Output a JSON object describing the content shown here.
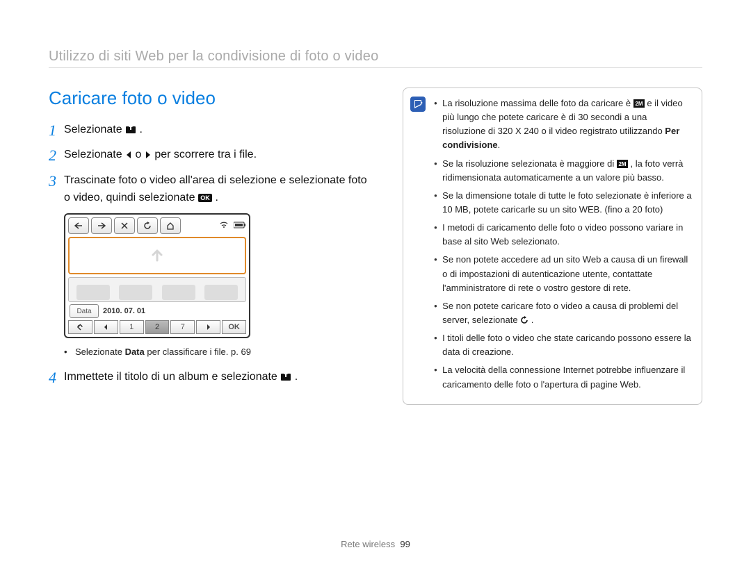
{
  "breadcrumb": "Utilizzo di siti Web per la condivisione di foto o video",
  "heading": "Caricare foto o video",
  "steps": {
    "s1": {
      "num": "1",
      "a": "Selezionate ",
      "b": "."
    },
    "s2": {
      "num": "2",
      "a": "Selezionate ",
      "b": " o ",
      "c": " per scorrere tra i file."
    },
    "s3": {
      "num": "3",
      "a": "Trascinate foto o video all'area di selezione e selezionate foto o video, quindi selezionate ",
      "b": "."
    },
    "s4": {
      "num": "4",
      "a": "Immettete il titolo di un album e selezionate ",
      "b": "."
    }
  },
  "cam": {
    "date_label": "Data",
    "date_value": "2010. 07. 01",
    "bottom": [
      "1",
      "2",
      "7"
    ]
  },
  "sub_bullet": {
    "a": "Selezionate ",
    "b_bold": "Data",
    "c": " per classificare i file. p. 69"
  },
  "notes": {
    "n1a": "La risoluzione massima delle foto da caricare è ",
    "n1b": " e il video più lungo che potete caricare è di 30 secondi a una risoluzione di 320 X 240 o il video registrato utilizzando ",
    "n1c_bold": "Per condivisione",
    "n1d": ".",
    "n2a": "Se la risoluzione selezionata è maggiore di ",
    "n2b": ", la foto verrà ridimensionata automaticamente a un valore più basso.",
    "n3": "Se la dimensione totale di tutte le foto selezionate è inferiore a 10 MB, potete caricarle su un sito WEB. (fino a 20 foto)",
    "n4": "I metodi di caricamento delle foto o video possono variare in base al sito Web selezionato.",
    "n5": "Se non potete accedere ad un sito Web a causa di un firewall o di impostazioni di autenticazione utente, contattate l'amministratore di rete o vostro gestore di rete.",
    "n6a": "Se non potete caricare foto o video a causa di problemi del server, selezionate ",
    "n6b": ".",
    "n7": "I titoli delle foto o video che state caricando possono essere la data di creazione.",
    "n8": "La velocità della connessione Internet potrebbe influenzare il caricamento delle foto o l'apertura di pagine Web."
  },
  "footer": {
    "section": "Rete wireless",
    "page": "99"
  }
}
